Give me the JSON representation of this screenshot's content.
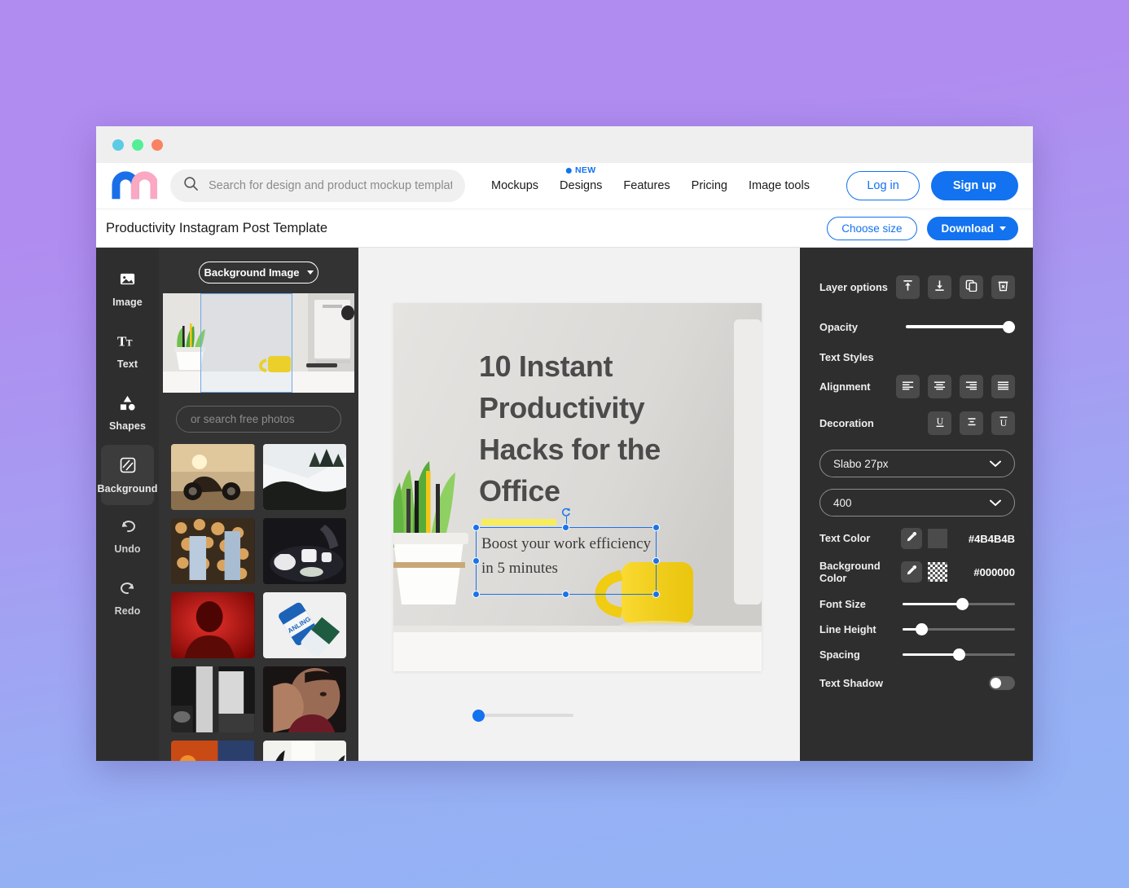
{
  "window": {
    "traffic_lights": [
      "cyan",
      "green",
      "coral"
    ]
  },
  "header": {
    "logo_name": "m-logo",
    "search": {
      "placeholder": "Search for design and product mockup templates",
      "value": "",
      "icon": "search-icon"
    },
    "nav": [
      {
        "label": "Mockups",
        "badge": null
      },
      {
        "label": "Designs",
        "badge": "NEW"
      },
      {
        "label": "Features",
        "badge": null
      },
      {
        "label": "Pricing",
        "badge": null
      },
      {
        "label": "Image tools",
        "badge": null
      }
    ],
    "login_label": "Log in",
    "signup_label": "Sign up",
    "accent": "#1272ef"
  },
  "docbar": {
    "title": "Productivity Instagram Post Template",
    "choose_size_label": "Choose size",
    "download_label": "Download"
  },
  "rail": {
    "items": [
      {
        "label": "Image",
        "icon": "image-icon",
        "active": false
      },
      {
        "label": "Text",
        "icon": "text-icon",
        "active": false
      },
      {
        "label": "Shapes",
        "icon": "shapes-icon",
        "active": false
      },
      {
        "label": "Background",
        "icon": "background-icon",
        "active": true
      },
      {
        "label": "Undo",
        "icon": "undo-icon",
        "active": false
      },
      {
        "label": "Redo",
        "icon": "redo-icon",
        "active": false
      }
    ]
  },
  "assets": {
    "dropdown_label": "Background Image",
    "photo_search_placeholder": "or search free photos",
    "photo_search_value": "",
    "thumbnails": [
      {
        "name": "motorcycle-sunset"
      },
      {
        "name": "snow-landscape"
      },
      {
        "name": "firewood-couple"
      },
      {
        "name": "tea-set"
      },
      {
        "name": "red-portrait"
      },
      {
        "name": "soda-cans"
      },
      {
        "name": "dark-interior"
      },
      {
        "name": "man-face-hand"
      },
      {
        "name": "fire-sky"
      },
      {
        "name": "white-plants"
      }
    ]
  },
  "canvas": {
    "design": {
      "headline": "10 Instant Productivity Hacks for the Office",
      "subtext": "Boost your work efficiency in 5 minutes",
      "headline_color": "#4b4b4b",
      "accent_bar_color": "#f7ed5a"
    },
    "zoom_slider_value": 0
  },
  "props": {
    "layer_options_label": "Layer options",
    "layer_buttons": [
      {
        "name": "bring-to-front-icon"
      },
      {
        "name": "send-to-back-icon"
      },
      {
        "name": "duplicate-icon"
      },
      {
        "name": "delete-icon"
      }
    ],
    "opacity_label": "Opacity",
    "opacity_value": 100,
    "text_styles_label": "Text Styles",
    "alignment_label": "Alignment",
    "alignment_buttons": [
      {
        "name": "align-left-icon"
      },
      {
        "name": "align-center-icon"
      },
      {
        "name": "align-right-icon"
      },
      {
        "name": "align-justify-icon"
      }
    ],
    "decoration_label": "Decoration",
    "decoration_buttons": [
      {
        "name": "underline-icon"
      },
      {
        "name": "strikethrough-icon"
      },
      {
        "name": "overline-icon"
      }
    ],
    "font_select_value": "Slabo 27px",
    "weight_select_value": "400",
    "text_color_label": "Text Color",
    "text_color_value": "#4B4B4B",
    "background_color_label": "Background Color",
    "background_color_value": "#000000",
    "font_size_label": "Font Size",
    "font_size_value": 53,
    "line_height_label": "Line Height",
    "line_height_value": 15,
    "spacing_label": "Spacing",
    "spacing_value": 50,
    "text_shadow_label": "Text Shadow",
    "text_shadow_on": false
  }
}
